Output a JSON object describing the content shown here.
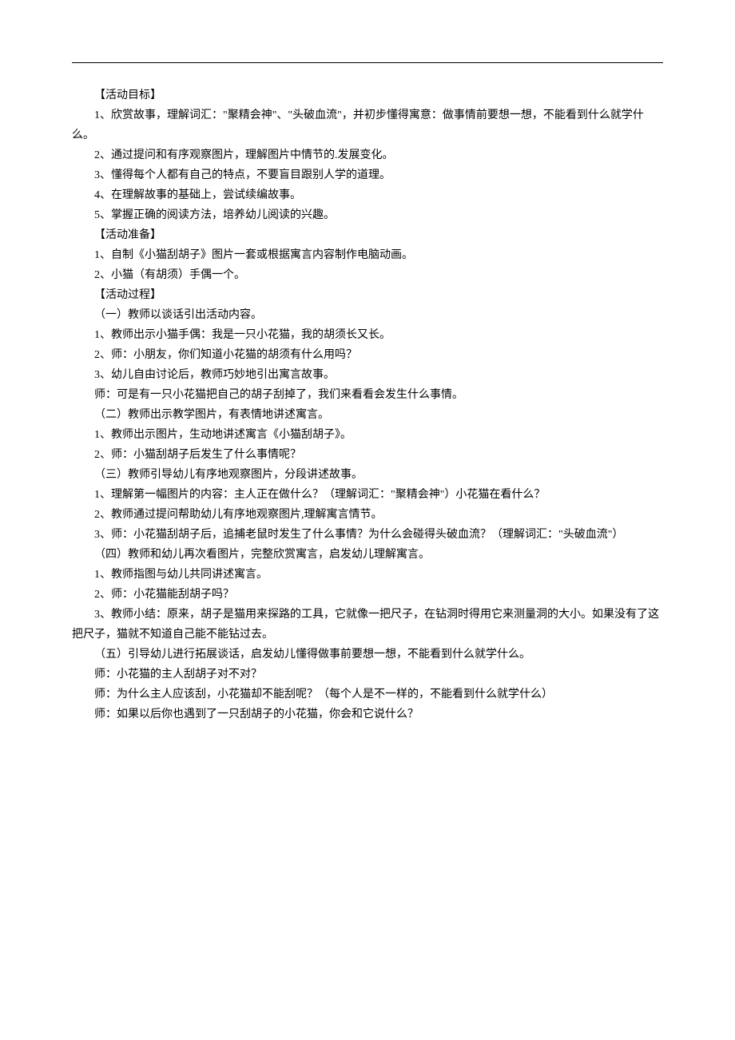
{
  "lines": [
    "【活动目标】",
    "1、欣赏故事，理解词汇：\"聚精会神\"、\"头破血流\"，并初步懂得寓意：做事情前要想一想，不能看到什么就学什么。",
    "2、通过提问和有序观察图片，理解图片中情节的.发展变化。",
    "3、懂得每个人都有自己的特点，不要盲目跟别人学的道理。",
    "4、在理解故事的基础上，尝试续编故事。",
    "5、掌握正确的阅读方法，培养幼儿阅读的兴趣。",
    "【活动准备】",
    "1、自制《小猫刮胡子》图片一套或根据寓言内容制作电脑动画。",
    "2、小猫（有胡须）手偶一个。",
    "【活动过程】",
    "（一）教师以谈话引出活动内容。",
    "1、教师出示小猫手偶：我是一只小花猫，我的胡须长又长。",
    "2、师：小朋友，你们知道小花猫的胡须有什么用吗？",
    "3、幼儿自由讨论后，教师巧妙地引出寓言故事。",
    "师：可是有一只小花猫把自己的胡子刮掉了，我们来看看会发生什么事情。",
    "（二）教师出示教学图片，有表情地讲述寓言。",
    "1、教师出示图片，生动地讲述寓言《小猫刮胡子》。",
    "2、师：小猫刮胡子后发生了什么事情呢？",
    "（三）教师引导幼儿有序地观察图片，分段讲述故事。",
    "1、理解第一幅图片的内容：主人正在做什么？（理解词汇：\"聚精会神\"）小花猫在看什么？",
    "2、教师通过提问帮助幼儿有序地观察图片,理解寓言情节。",
    "3、师：小花猫刮胡子后，追捕老鼠时发生了什么事情？为什么会碰得头破血流？（理解词汇：\"头破血流\"）",
    "（四）教师和幼儿再次看图片，完整欣赏寓言，启发幼儿理解寓言。",
    "1、教师指图与幼儿共同讲述寓言。",
    "2、师：小花猫能刮胡子吗？",
    "3、教师小结：原来，胡子是猫用来探路的工具，它就像一把尺子，在钻洞时得用它来测量洞的大小。如果没有了这把尺子，猫就不知道自己能不能钻过去。",
    "（五）引导幼儿进行拓展谈话，启发幼儿懂得做事前要想一想，不能看到什么就学什么。",
    "师：小花猫的主人刮胡子对不对？",
    "师：为什么主人应该刮，小花猫却不能刮呢？（每个人是不一样的，不能看到什么就学什么）",
    "师：如果以后你也遇到了一只刮胡子的小花猫，你会和它说什么？"
  ]
}
